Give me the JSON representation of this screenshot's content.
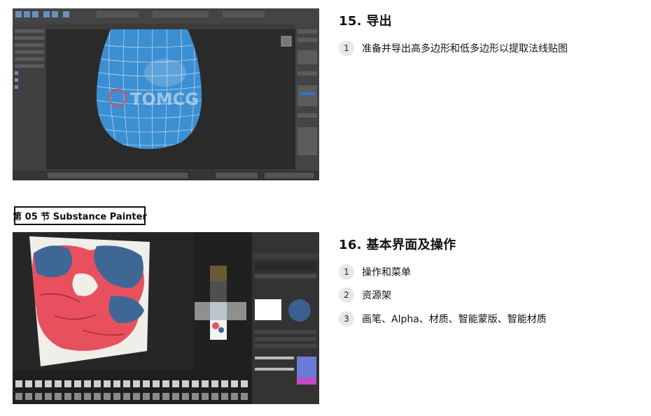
{
  "section15": {
    "title": "15. 导出",
    "steps": [
      {
        "num": "1",
        "text": "准备并导出高多边形和低多边形以提取法线贴图"
      }
    ]
  },
  "badge": "第 05 节 Substance Painter",
  "section16": {
    "title": "16. 基本界面及操作",
    "steps": [
      {
        "num": "1",
        "text": "操作和菜单"
      },
      {
        "num": "2",
        "text": "资源架"
      },
      {
        "num": "3",
        "text": "画笔、Alpha、材质、智能蒙版、智能材质"
      }
    ]
  },
  "screenshot1": {
    "watermark": "TOMCG",
    "colors": {
      "viewport": "#2d2d2d",
      "model": "#3f8fd1",
      "wire": "#cfe3f5"
    }
  },
  "screenshot2": {
    "colors": {
      "bg": "#262626",
      "paint_red": "#e8505e",
      "paint_blue": "#3f6796",
      "canvas": "#efeee8"
    }
  }
}
